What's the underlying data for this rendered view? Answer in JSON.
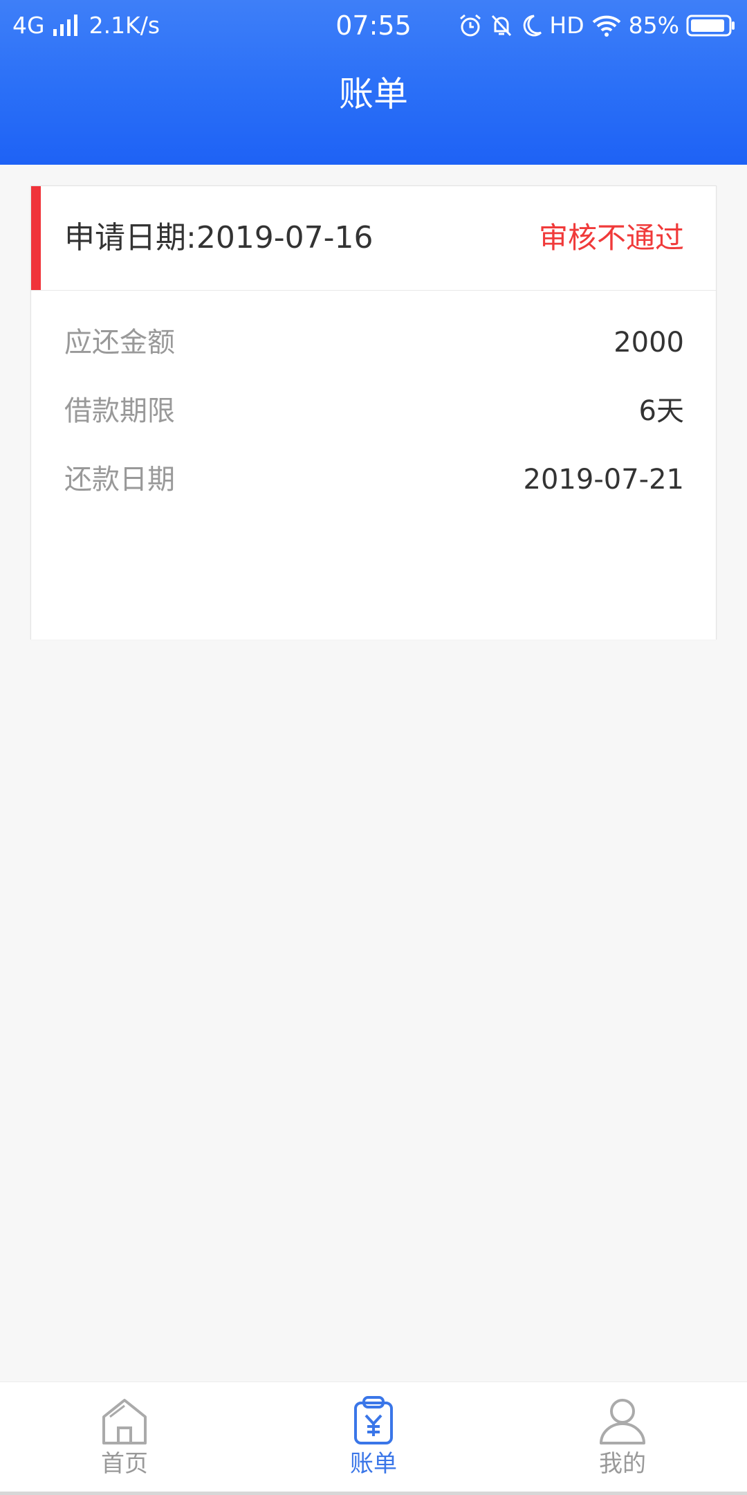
{
  "status_bar": {
    "network": "4G",
    "speed": "2.1K/s",
    "time": "07:55",
    "hd": "HD",
    "battery": "85%"
  },
  "header": {
    "title": "账单"
  },
  "bill": {
    "apply_date": "申请日期:2019-07-16",
    "status": "审核不通过",
    "rows": [
      {
        "label": "应还金额",
        "value": "2000"
      },
      {
        "label": "借款期限",
        "value": "6天"
      },
      {
        "label": "还款日期",
        "value": "2019-07-21"
      }
    ]
  },
  "tabs": [
    {
      "label": "首页",
      "icon": "home-icon",
      "active": false
    },
    {
      "label": "账单",
      "icon": "bill-icon",
      "active": true
    },
    {
      "label": "我的",
      "icon": "user-icon",
      "active": false
    }
  ],
  "colors": {
    "primary": "#2a6ff7",
    "accent_red": "#f0333a",
    "tab_active": "#3a76e8",
    "tab_inactive": "#999999"
  }
}
